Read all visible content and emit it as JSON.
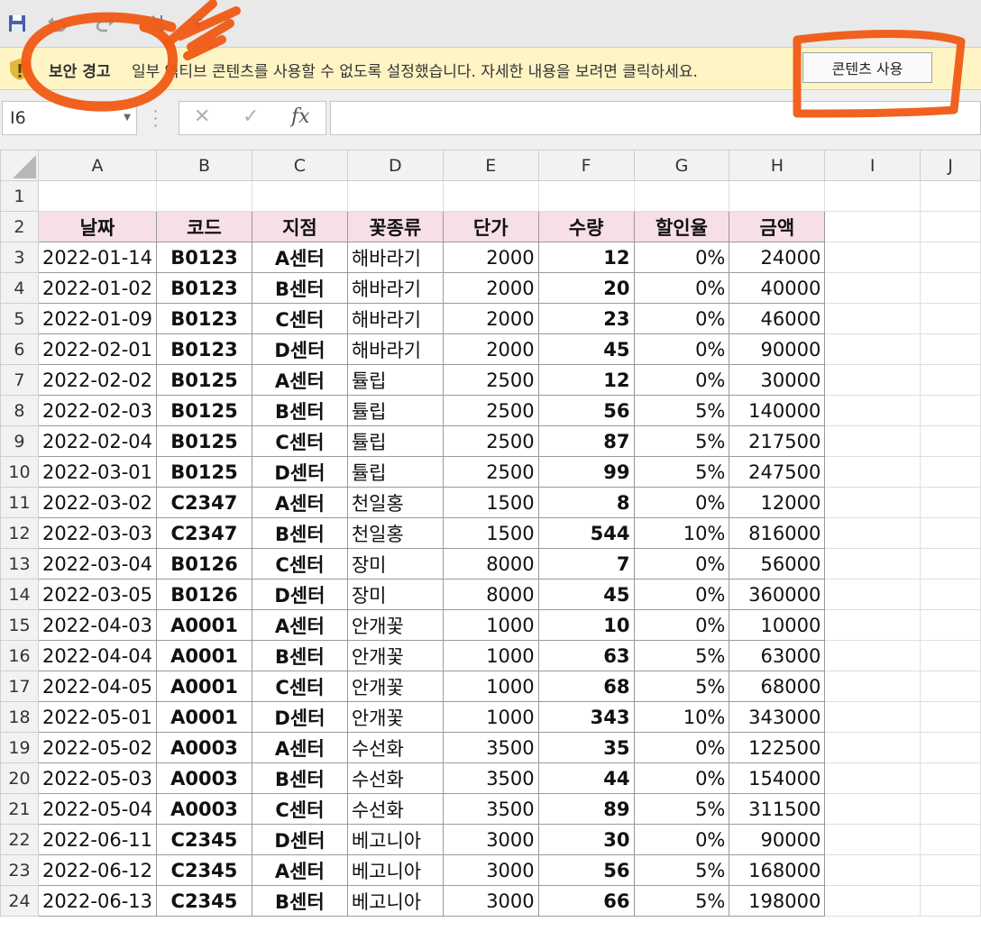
{
  "quick_access": {
    "save_icon": "save-icon",
    "undo_icon": "undo-icon",
    "redo_icon": "redo-icon",
    "sort_icon": "sort-icon",
    "customize_icon": "customize-dropdown-icon"
  },
  "security_bar": {
    "title": "보안 경고",
    "message": "일부 액티브 콘텐츠를 사용할 수 없도록 설정했습니다. 자세한 내용을 보려면 클릭하세요.",
    "enable_button": "콘텐츠 사용"
  },
  "formula_bar": {
    "name_box": "I6",
    "cancel_glyph": "✕",
    "enter_glyph": "✓",
    "fx_glyph": "fx",
    "formula_value": ""
  },
  "columns": [
    "A",
    "B",
    "C",
    "D",
    "E",
    "F",
    "G",
    "H",
    "I",
    "J"
  ],
  "table": {
    "headers": [
      "날짜",
      "코드",
      "지점",
      "꽃종류",
      "단가",
      "수량",
      "할인율",
      "금액"
    ],
    "rows": [
      [
        "2022-01-14",
        "B0123",
        "A센터",
        "해바라기",
        "2000",
        "12",
        "0%",
        "24000"
      ],
      [
        "2022-01-02",
        "B0123",
        "B센터",
        "해바라기",
        "2000",
        "20",
        "0%",
        "40000"
      ],
      [
        "2022-01-09",
        "B0123",
        "C센터",
        "해바라기",
        "2000",
        "23",
        "0%",
        "46000"
      ],
      [
        "2022-02-01",
        "B0123",
        "D센터",
        "해바라기",
        "2000",
        "45",
        "0%",
        "90000"
      ],
      [
        "2022-02-02",
        "B0125",
        "A센터",
        "튤립",
        "2500",
        "12",
        "0%",
        "30000"
      ],
      [
        "2022-02-03",
        "B0125",
        "B센터",
        "튤립",
        "2500",
        "56",
        "5%",
        "140000"
      ],
      [
        "2022-02-04",
        "B0125",
        "C센터",
        "튤립",
        "2500",
        "87",
        "5%",
        "217500"
      ],
      [
        "2022-03-01",
        "B0125",
        "D센터",
        "튤립",
        "2500",
        "99",
        "5%",
        "247500"
      ],
      [
        "2022-03-02",
        "C2347",
        "A센터",
        "천일홍",
        "1500",
        "8",
        "0%",
        "12000"
      ],
      [
        "2022-03-03",
        "C2347",
        "B센터",
        "천일홍",
        "1500",
        "544",
        "10%",
        "816000"
      ],
      [
        "2022-03-04",
        "B0126",
        "C센터",
        "장미",
        "8000",
        "7",
        "0%",
        "56000"
      ],
      [
        "2022-03-05",
        "B0126",
        "D센터",
        "장미",
        "8000",
        "45",
        "0%",
        "360000"
      ],
      [
        "2022-04-03",
        "A0001",
        "A센터",
        "안개꽃",
        "1000",
        "10",
        "0%",
        "10000"
      ],
      [
        "2022-04-04",
        "A0001",
        "B센터",
        "안개꽃",
        "1000",
        "63",
        "5%",
        "63000"
      ],
      [
        "2022-04-05",
        "A0001",
        "C센터",
        "안개꽃",
        "1000",
        "68",
        "5%",
        "68000"
      ],
      [
        "2022-05-01",
        "A0001",
        "D센터",
        "안개꽃",
        "1000",
        "343",
        "10%",
        "343000"
      ],
      [
        "2022-05-02",
        "A0003",
        "A센터",
        "수선화",
        "3500",
        "35",
        "0%",
        "122500"
      ],
      [
        "2022-05-03",
        "A0003",
        "B센터",
        "수선화",
        "3500",
        "44",
        "0%",
        "154000"
      ],
      [
        "2022-05-04",
        "A0003",
        "C센터",
        "수선화",
        "3500",
        "89",
        "5%",
        "311500"
      ],
      [
        "2022-06-11",
        "C2345",
        "D센터",
        "베고니아",
        "3000",
        "30",
        "0%",
        "90000"
      ],
      [
        "2022-06-12",
        "C2345",
        "A센터",
        "베고니아",
        "3000",
        "56",
        "5%",
        "168000"
      ],
      [
        "2022-06-13",
        "C2345",
        "B센터",
        "베고니아",
        "3000",
        "66",
        "5%",
        "198000"
      ]
    ]
  },
  "colors": {
    "header_fill": "#f7dfe6",
    "security_bar": "#fff4c4",
    "annotation": "#f05a14"
  }
}
